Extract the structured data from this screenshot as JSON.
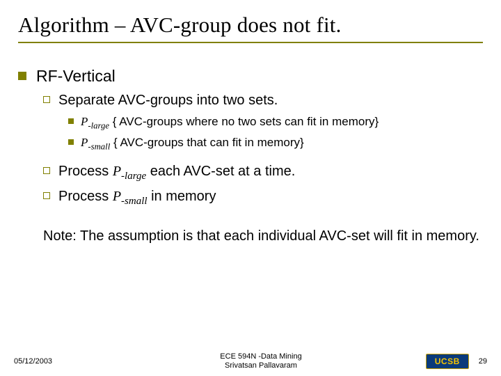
{
  "title": "Algorithm – AVC-group does not fit.",
  "heading1": "RF-Vertical",
  "sub1": "Separate AVC-groups into two sets.",
  "b1_pre": "P",
  "b1_sub": "-large",
  "b1_post": " { AVC-groups where no two sets can fit in memory}",
  "b2_pre": "P",
  "b2_sub": "-small",
  "b2_post": " { AVC-groups that can fit in memory}",
  "sub2_pre": "Process ",
  "sub2_p": "P",
  "sub2_sub": "-large",
  "sub2_post": " each AVC-set at a time.",
  "sub3_pre": "Process ",
  "sub3_p": "P",
  "sub3_sub": "-small",
  "sub3_post": " in memory",
  "note": "Note: The assumption is that each individual AVC-set will fit in memory.",
  "footer": {
    "date": "05/12/2003",
    "line1": "ECE 594N -Data Mining",
    "line2": "Srivatsan Pallavaram",
    "logo": "UCSB",
    "page": "29"
  }
}
